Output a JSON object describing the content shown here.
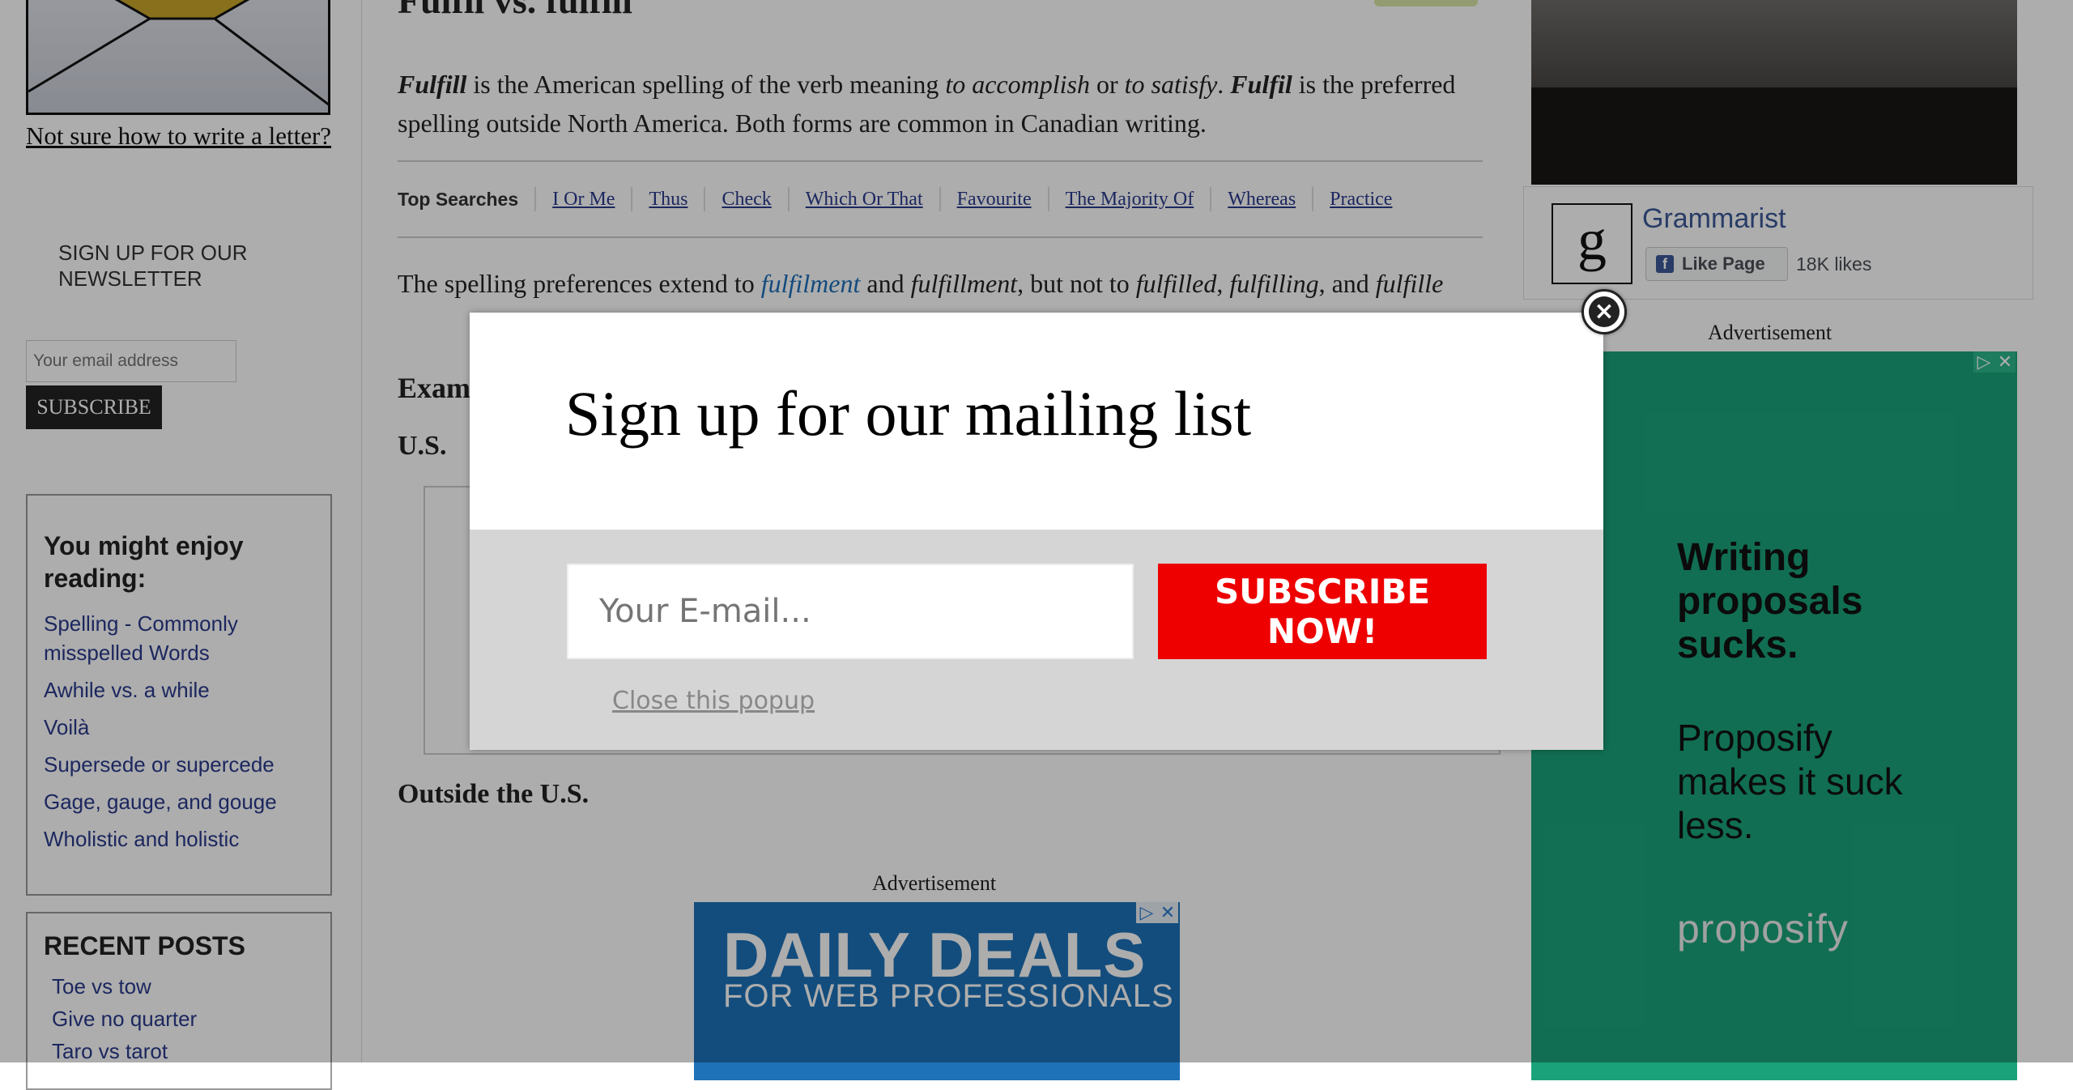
{
  "left": {
    "letter_link": "Not sure how to write a letter?",
    "newsletter_title": "SIGN UP FOR OUR NEWSLETTER",
    "email_placeholder": "Your email address",
    "subscribe_label": "SUBSCRIBE",
    "enjoy": {
      "title": "You might enjoy reading:",
      "items": [
        "Spelling - Commonly misspelled Words",
        "Awhile vs. a while",
        "Voilà",
        "Supersede or supercede",
        "Gage, gauge, and gouge",
        "Wholistic and holistic"
      ]
    },
    "recent": {
      "title": "RECENT POSTS",
      "items": [
        "Toe vs tow",
        "Give no quarter",
        "Taro vs tarot"
      ]
    }
  },
  "main": {
    "title": "Fulfil vs. fulfill",
    "intro": {
      "w1": "Fulfill",
      "t1": " is the American spelling of the verb meaning ",
      "i1": "to accomplish",
      "t2": " or ",
      "i2": "to satisfy",
      "t3": ". ",
      "w2": "Fulfil",
      "t4": " is the preferred spelling outside North America. Both forms are common in Canadian writing."
    },
    "top_searches": {
      "label": "Top Searches",
      "links": [
        "I Or Me",
        "Thus",
        "Check",
        "Which Or That",
        "Favourite",
        "The Majority Of",
        "Whereas",
        "Practice"
      ]
    },
    "spelling": {
      "t1": "The spelling preferences extend to ",
      "link": "fulfilment",
      "t2": " and ",
      "i1": "fulfillment",
      "t3": ", but not to ",
      "i2": "fulfilled",
      "t4": ", ",
      "i3": "fulfilling",
      "t5": ", and ",
      "i4": "fulfille"
    },
    "examples_heading": "Exam",
    "us_heading": "U.S.",
    "outside_heading": "Outside the U.S.",
    "ad_label": "Advertisement",
    "ad_line1": "DAILY DEALS",
    "ad_line2": "FOR WEB PROFESSIONALS"
  },
  "right": {
    "fb_name": "Grammarist",
    "fb_logo": "g",
    "fb_like": "Like Page",
    "fb_likes": "18K likes",
    "ad_label": "Advertisement",
    "ad_head": "Writing proposals sucks.",
    "ad_sub": "Proposify makes it suck less.",
    "ad_brand": "proposify"
  },
  "popup": {
    "title": "Sign up for our mailing list",
    "email_placeholder": "Your E-mail...",
    "subscribe_label": "SUBSCRIBE NOW!",
    "close_link": "Close this popup",
    "close_icon": "×"
  },
  "colors": {
    "subscribe_red": "#ee0000",
    "popup_band": "#d5d5d5",
    "ad_green": "#1aa37a",
    "ad_blue": "#1d72b8",
    "link_blue": "#2a3a8c"
  }
}
